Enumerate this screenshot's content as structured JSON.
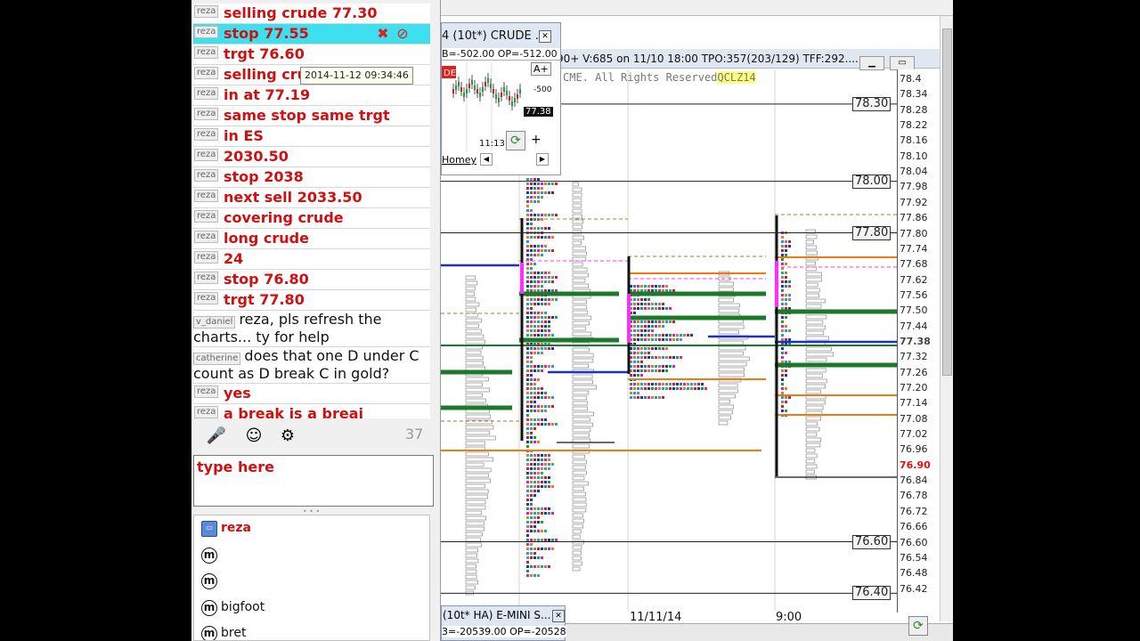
{
  "chat": {
    "messages": [
      {
        "user": "reza",
        "text": "selling crude 77.30",
        "style": "bold"
      },
      {
        "user": "reza",
        "text": "stop 77.55",
        "style": "bold",
        "highlight": true
      },
      {
        "user": "reza",
        "text": "trgt 76.60",
        "style": "bold"
      },
      {
        "user": "reza",
        "text": "selling cru",
        "style": "bold"
      },
      {
        "user": "reza",
        "text": "in at 77.19",
        "style": "bold"
      },
      {
        "user": "reza",
        "text": "same stop same trgt",
        "style": "bold"
      },
      {
        "user": "reza",
        "text": "in ES",
        "style": "bold"
      },
      {
        "user": "reza",
        "text": "2030.50",
        "style": "bold"
      },
      {
        "user": "reza",
        "text": "stop 2038",
        "style": "bold"
      },
      {
        "user": "reza",
        "text": "next sell 2033.50",
        "style": "bold"
      },
      {
        "user": "reza",
        "text": "covering crude",
        "style": "bold"
      },
      {
        "user": "reza",
        "text": "long crude",
        "style": "bold"
      },
      {
        "user": "reza",
        "text": "24",
        "style": "bold"
      },
      {
        "user": "reza",
        "text": "stop 76.80",
        "style": "bold"
      },
      {
        "user": "reza",
        "text": "trgt 77.80",
        "style": "bold"
      },
      {
        "user": "v_daniel",
        "text": "reza, pls refresh the charts... ty for help",
        "style": "plain"
      },
      {
        "user": "catherine",
        "text": "does that one D under C count as D break C in gold?",
        "style": "plain"
      },
      {
        "user": "reza",
        "text": "yes",
        "style": "bold"
      },
      {
        "user": "reza",
        "text": "a break is a breai",
        "style": "bold"
      }
    ],
    "tooltip": "2014-11-12 09:34:46",
    "message_count": "37",
    "input_placeholder": "type here",
    "users": [
      {
        "name": "reza",
        "role": "owner",
        "icon": "monitor"
      },
      {
        "name": "",
        "role": "member",
        "icon": "m"
      },
      {
        "name": "",
        "role": "member",
        "icon": "m"
      },
      {
        "name": "bigfoot",
        "role": "member",
        "icon": "m"
      },
      {
        "name": "bret",
        "role": "member",
        "icon": "m"
      }
    ]
  },
  "mini_chart": {
    "title": "4 (10t*) CRUDE ...",
    "info": "B=-502.00 OP=-512.00",
    "font_size_label": "A+",
    "scale_label": "-500",
    "price": "77.38",
    "time": "11:13",
    "tab": "Homey",
    "symbol_tag": "DE"
  },
  "main_chart": {
    "title": "90+ V:685 on 11/10 18:00 TPO:357(203/129) TFF:292....",
    "copyright": "CME. All Rights Reserved",
    "symbol": "QCLZ14",
    "price_labels": [
      "78.30",
      "78.00",
      "77.80",
      "76.60",
      "76.40"
    ],
    "y_ticks": [
      "78.4",
      "78.34",
      "78.28",
      "78.22",
      "78.16",
      "78.10",
      "78.04",
      "77.98",
      "77.92",
      "77.86",
      "77.80",
      "77.74",
      "77.68",
      "77.62",
      "77.56",
      "77.50",
      "77.44",
      "77.38",
      "77.32",
      "77.26",
      "77.20",
      "77.14",
      "77.08",
      "77.02",
      "76.96",
      "76.90",
      "76.84",
      "76.78",
      "76.72",
      "76.66",
      "76.60",
      "76.54",
      "76.48",
      "76.42"
    ],
    "current_price": "77.38",
    "stop_price": "76.90",
    "x_labels": [
      "11/11/14",
      "9:00"
    ],
    "colors": {
      "accent_green": "#1a7a2a",
      "orange": "#f07a10",
      "blue": "#1a30d0",
      "magenta": "#ff30ff",
      "olive": "#9a8a20"
    }
  },
  "bottom_chart": {
    "title": "(10t* HA) E-MINI S...",
    "info": "3=-20539.00 OP=-20528"
  }
}
